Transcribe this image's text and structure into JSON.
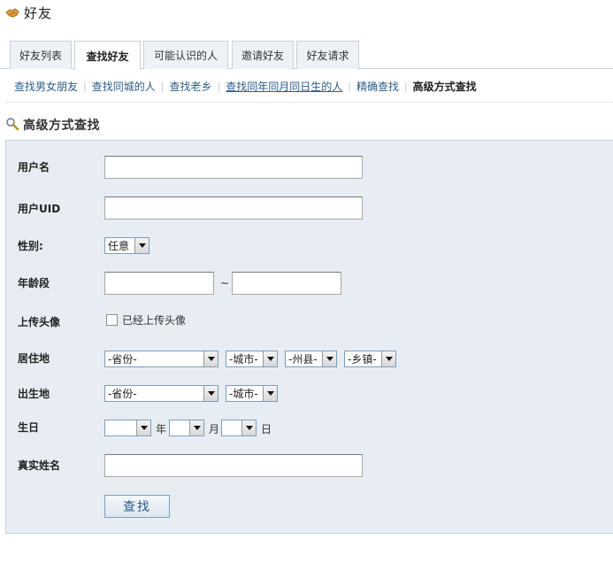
{
  "header": {
    "title": "好友",
    "icon": "handshake-icon"
  },
  "tabs": [
    {
      "label": "好友列表"
    },
    {
      "label": "查找好友"
    },
    {
      "label": "可能认识的人"
    },
    {
      "label": "邀请好友"
    },
    {
      "label": "好友请求"
    }
  ],
  "subnav": {
    "links": [
      "查找男女朋友",
      "查找同城的人",
      "查找老乡",
      "查找同年同月同日生的人",
      "精确查找"
    ],
    "current": "高级方式查找"
  },
  "section": {
    "title": "高级方式查找",
    "icon": "magnifier-icon"
  },
  "form": {
    "username_label": "用户名",
    "uid_label": "用户UID",
    "gender_label": "性别:",
    "gender_value": "任意",
    "age_label": "年龄段",
    "age_separator": "~",
    "avatar_label": "上传头像",
    "avatar_checkbox_label": "已经上传头像",
    "residence_label": "居住地",
    "residence": {
      "province": "-省份-",
      "city": "-城市-",
      "county": "-州县-",
      "town": "-乡镇-"
    },
    "birthplace_label": "出生地",
    "birthplace": {
      "province": "-省份-",
      "city": "-城市-"
    },
    "birthday_label": "生日",
    "birthday": {
      "year_unit": "年",
      "month_unit": "月",
      "day_unit": "日"
    },
    "realname_label": "真实姓名",
    "submit_label": "查找"
  },
  "colors": {
    "panel_bg": "#e7edf3",
    "link": "#2a5c8a",
    "border": "#c6cfd8"
  }
}
